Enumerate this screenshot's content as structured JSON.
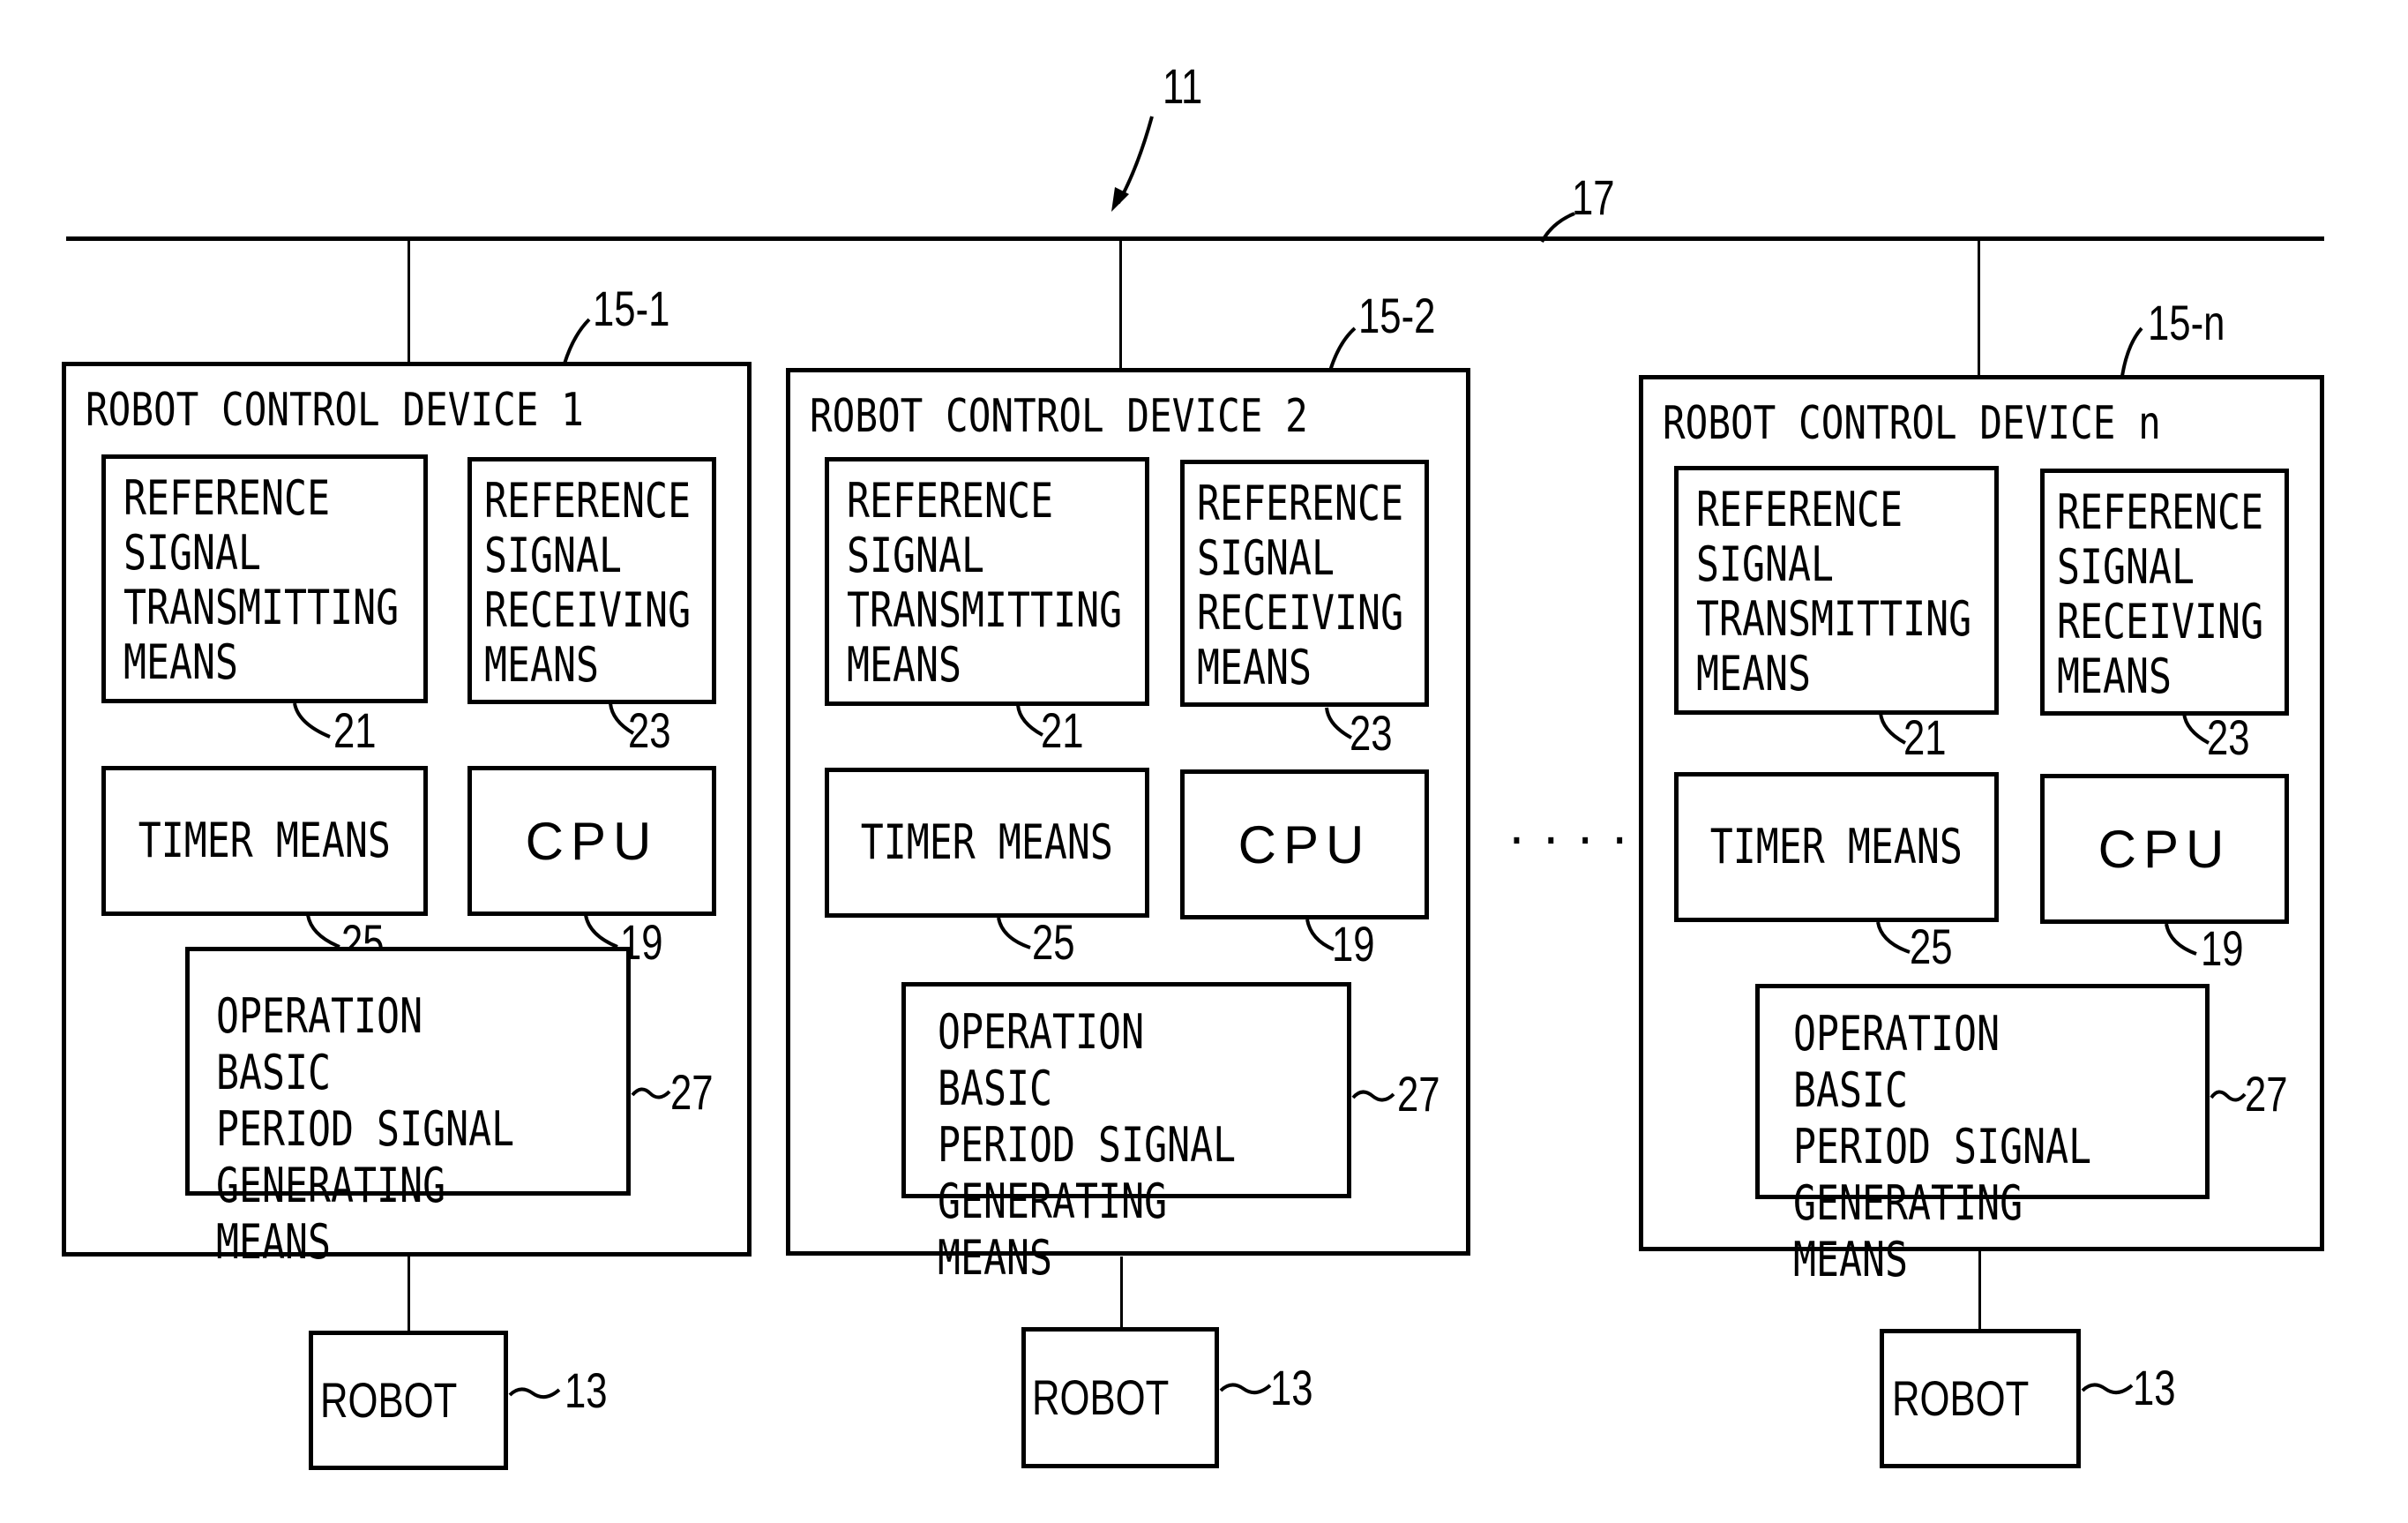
{
  "figure": {
    "system_ref": "11",
    "bus_ref": "17",
    "ellipsis": "......",
    "devices": [
      {
        "ref": "15-1",
        "title": "ROBOT CONTROL DEVICE 1",
        "tx": {
          "label": "REFERENCE\nSIGNAL\nTRANSMITTING\nMEANS",
          "ref": "21"
        },
        "rx": {
          "label": "REFERENCE\nSIGNAL\nRECEIVING\nMEANS",
          "ref": "23"
        },
        "timer": {
          "label": "TIMER MEANS",
          "ref": "25"
        },
        "cpu": {
          "label": "CPU",
          "ref": "19"
        },
        "opgen": {
          "label": "OPERATION BASIC\nPERIOD SIGNAL\nGENERATING MEANS",
          "ref": "27"
        },
        "robot": {
          "label": "ROBOT",
          "ref": "13"
        }
      },
      {
        "ref": "15-2",
        "title": "ROBOT CONTROL DEVICE 2",
        "tx": {
          "label": "REFERENCE\nSIGNAL\nTRANSMITTING\nMEANS",
          "ref": "21"
        },
        "rx": {
          "label": "REFERENCE\nSIGNAL\nRECEIVING\nMEANS",
          "ref": "23"
        },
        "timer": {
          "label": "TIMER MEANS",
          "ref": "25"
        },
        "cpu": {
          "label": "CPU",
          "ref": "19"
        },
        "opgen": {
          "label": "OPERATION BASIC\nPERIOD SIGNAL\nGENERATING MEANS",
          "ref": "27"
        },
        "robot": {
          "label": "ROBOT",
          "ref": "13"
        }
      },
      {
        "ref": "15-n",
        "title": "ROBOT CONTROL DEVICE n",
        "tx": {
          "label": "REFERENCE\nSIGNAL\nTRANSMITTING\nMEANS",
          "ref": "21"
        },
        "rx": {
          "label": "REFERENCE\nSIGNAL\nRECEIVING\nMEANS",
          "ref": "23"
        },
        "timer": {
          "label": "TIMER MEANS",
          "ref": "25"
        },
        "cpu": {
          "label": "CPU",
          "ref": "19"
        },
        "opgen": {
          "label": "OPERATION BASIC\nPERIOD SIGNAL\nGENERATING MEANS",
          "ref": "27"
        },
        "robot": {
          "label": "ROBOT",
          "ref": "13"
        }
      }
    ]
  }
}
